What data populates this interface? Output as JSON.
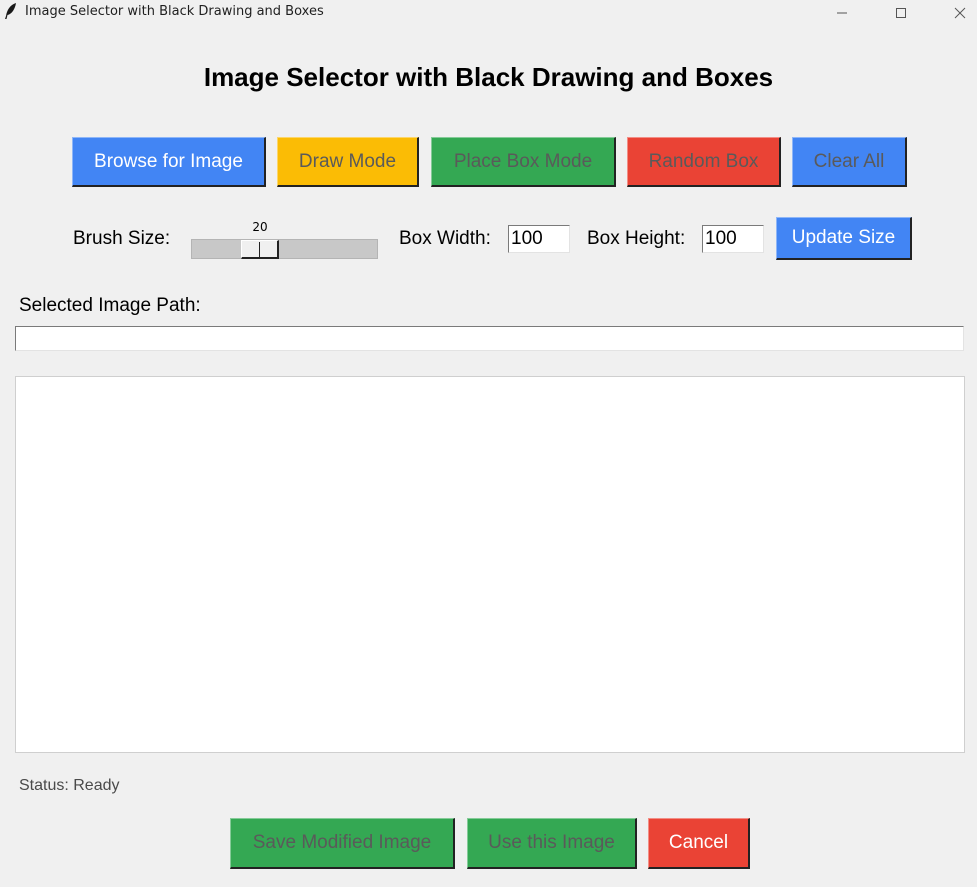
{
  "window": {
    "title": "Image Selector with Black Drawing and Boxes",
    "icon": "feather-icon"
  },
  "heading": "Image Selector with Black Drawing and Boxes",
  "toolbar": {
    "browse": "Browse for Image",
    "draw_mode": "Draw Mode",
    "place_box_mode": "Place Box Mode",
    "random_box": "Random Box",
    "clear_all": "Clear All"
  },
  "settings": {
    "brush_size_label": "Brush Size:",
    "brush_size_value": "20",
    "box_width_label": "Box Width:",
    "box_width_value": "100",
    "box_height_label": "Box Height:",
    "box_height_value": "100",
    "update_size": "Update Size"
  },
  "path": {
    "label": "Selected Image Path:",
    "value": ""
  },
  "status": "Status: Ready",
  "actions": {
    "save": "Save Modified Image",
    "use": "Use this Image",
    "cancel": "Cancel"
  },
  "colors": {
    "blue": "#4285f4",
    "yellow": "#fbbc05",
    "green": "#34a853",
    "red": "#ea4335"
  }
}
